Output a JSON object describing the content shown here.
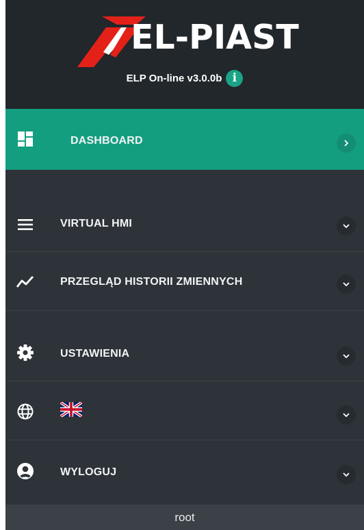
{
  "header": {
    "brand": "EL-PIAST",
    "version": "ELP On-line v3.0.0b",
    "info_icon": "info-icon",
    "colors": {
      "accent": "#149e80",
      "logo_red": "#e32119",
      "header_bg": "#22272b",
      "sidebar_bg": "#2d3338"
    }
  },
  "menu": {
    "dashboard": {
      "label": "DASHBOARD",
      "icon": "dashboard-icon"
    },
    "virtual_hmi": {
      "label": "VIRTUAL HMI",
      "icon": "menu-icon"
    },
    "history": {
      "label": "PRZEGLĄD HISTORII ZMIENNYCH",
      "icon": "trend-line-icon"
    },
    "settings": {
      "label": "USTAWIENIA",
      "icon": "gear-icon"
    },
    "language": {
      "icon": "globe-icon",
      "flag": "uk-flag-icon"
    },
    "logout": {
      "label": "WYLOGUJ",
      "icon": "account-icon"
    }
  },
  "footer": {
    "user": "root"
  }
}
